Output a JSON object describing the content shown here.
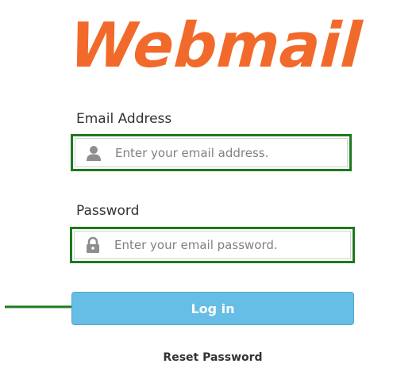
{
  "logo": {
    "text": "Webmail",
    "color": "#f26a2b"
  },
  "email": {
    "label": "Email Address",
    "placeholder": "Enter your email address.",
    "value": "",
    "icon": "user-icon"
  },
  "password": {
    "label": "Password",
    "placeholder": "Enter your email password.",
    "value": "",
    "icon": "lock-icon"
  },
  "login_button": {
    "label": "Log in",
    "color": "#66bde5"
  },
  "reset_link": {
    "label": "Reset Password"
  },
  "annotations": {
    "highlight_color": "#1d7a1d",
    "arrow": "arrow-right-icon"
  }
}
